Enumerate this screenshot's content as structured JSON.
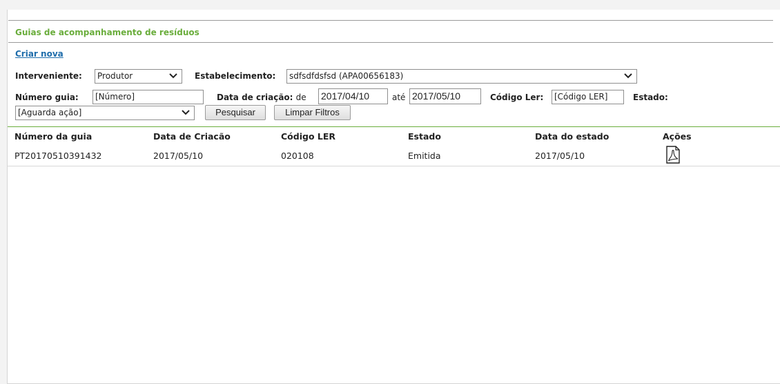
{
  "page": {
    "title": "Guias de acompanhamento de resíduos",
    "create_link": "Criar nova"
  },
  "filters": {
    "interveniente_label": "Interveniente:",
    "interveniente_value": "Produtor",
    "estabelecimento_label": "Estabelecimento:",
    "estabelecimento_value": "sdfsdfdsfsd (APA00656183)",
    "numero_label": "Número guia:",
    "numero_placeholder": "[Número]",
    "data_label": "Data de criação:",
    "de_label": "de",
    "data_de_value": "2017/04/10",
    "ate_label": "até",
    "data_ate_value": "2017/05/10",
    "codigo_label": "Código Ler:",
    "codigo_placeholder": "[Código LER]",
    "estado_label": "Estado:",
    "estado_value": "[Aguarda ação]",
    "search_button": "Pesquisar",
    "clear_button": "Limpar Filtros"
  },
  "table": {
    "columns": [
      "Número da guia",
      "Data de Criacão",
      "Código LER",
      "Estado",
      "Data do estado",
      "Ações"
    ],
    "rows": [
      {
        "numero": "PT20170510391432",
        "data_criacao": "2017/05/10",
        "codigo": "020108",
        "estado": "Emitida",
        "data_estado": "2017/05/10",
        "action_icon": "pdf-icon"
      }
    ]
  },
  "colors": {
    "accent": "#6aad3c",
    "link": "#1f6dab"
  }
}
